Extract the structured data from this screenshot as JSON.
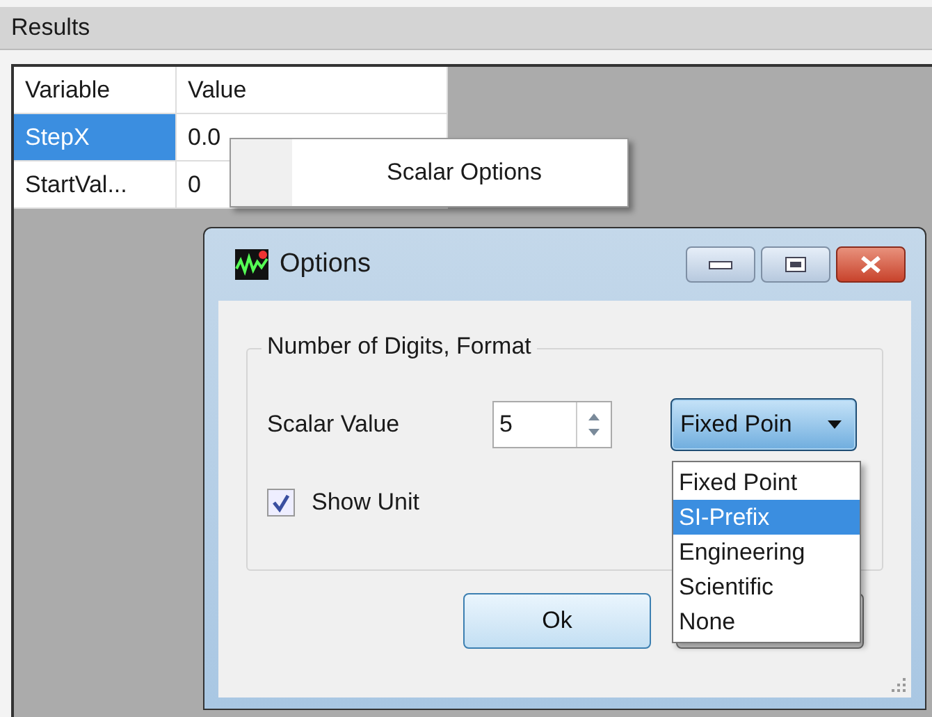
{
  "panel": {
    "title": "Results"
  },
  "table": {
    "columns": [
      "Variable",
      "Value"
    ],
    "rows": [
      {
        "cells": [
          "StepX",
          "0.0"
        ],
        "selected": true
      },
      {
        "cells": [
          "StartVal...",
          "0"
        ],
        "selected": false
      }
    ]
  },
  "context_menu": {
    "items": [
      "Scalar Options"
    ]
  },
  "dialog": {
    "title": "Options",
    "group": {
      "title": "Number of Digits, Format",
      "scalar_label": "Scalar Value",
      "digits": "5",
      "format": {
        "value": "Fixed Poin",
        "expanded": true,
        "options": [
          {
            "label": "Fixed Point",
            "selected": false
          },
          {
            "label": "SI-Prefix",
            "selected": true
          },
          {
            "label": "Engineering",
            "selected": false
          },
          {
            "label": "Scientific",
            "selected": false
          },
          {
            "label": "None",
            "selected": false
          }
        ]
      },
      "show_unit": {
        "label": "Show Unit",
        "checked": true
      }
    },
    "buttons": [
      {
        "kind": "ok",
        "label": "Ok"
      },
      {
        "kind": "cancel"
      }
    ]
  }
}
